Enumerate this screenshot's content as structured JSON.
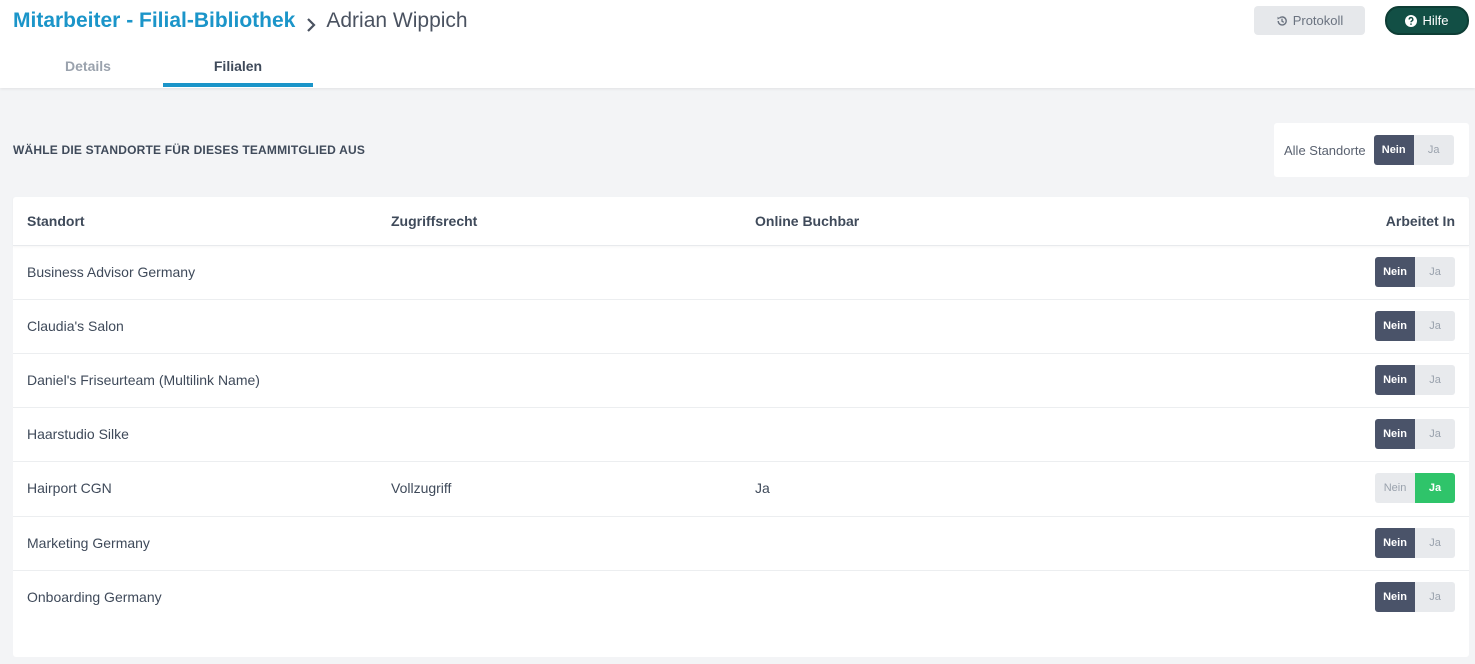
{
  "breadcrumb": {
    "parent": "Mitarbeiter - Filial-Bibliothek",
    "current": "Adrian Wippich"
  },
  "buttons": {
    "protokoll": "Protokoll",
    "hilfe": "Hilfe"
  },
  "tabs": [
    {
      "label": "Details",
      "active": false
    },
    {
      "label": "Filialen",
      "active": true
    }
  ],
  "selection": {
    "heading": "WÄHLE DIE STANDORTE FÜR DIESES TEAMMITGLIED AUS",
    "all_label": "Alle Standorte",
    "all_value": "Nein",
    "no_label": "Nein",
    "yes_label": "Ja"
  },
  "table": {
    "columns": [
      "Standort",
      "Zugriffsrecht",
      "Online Buchbar",
      "Arbeitet In"
    ],
    "rows": [
      {
        "standort": "Business Advisor Germany",
        "zugriff": "",
        "online": "",
        "arbeitet": "Nein"
      },
      {
        "standort": "Claudia's Salon",
        "zugriff": "",
        "online": "",
        "arbeitet": "Nein"
      },
      {
        "standort": "Daniel's Friseurteam (Multilink Name)",
        "zugriff": "",
        "online": "",
        "arbeitet": "Nein"
      },
      {
        "standort": "Haarstudio Silke",
        "zugriff": "",
        "online": "",
        "arbeitet": "Nein"
      },
      {
        "standort": "Hairport CGN",
        "zugriff": "Vollzugriff",
        "online": "Ja",
        "arbeitet": "Ja"
      },
      {
        "standort": "Marketing Germany",
        "zugriff": "",
        "online": "",
        "arbeitet": "Nein"
      },
      {
        "standort": "Onboarding Germany",
        "zugriff": "",
        "online": "",
        "arbeitet": "Nein"
      }
    ]
  },
  "colors": {
    "accent": "#1b95c9",
    "help_button": "#124f45",
    "toggle_dark": "#4a5369",
    "toggle_green": "#2fc46a"
  }
}
